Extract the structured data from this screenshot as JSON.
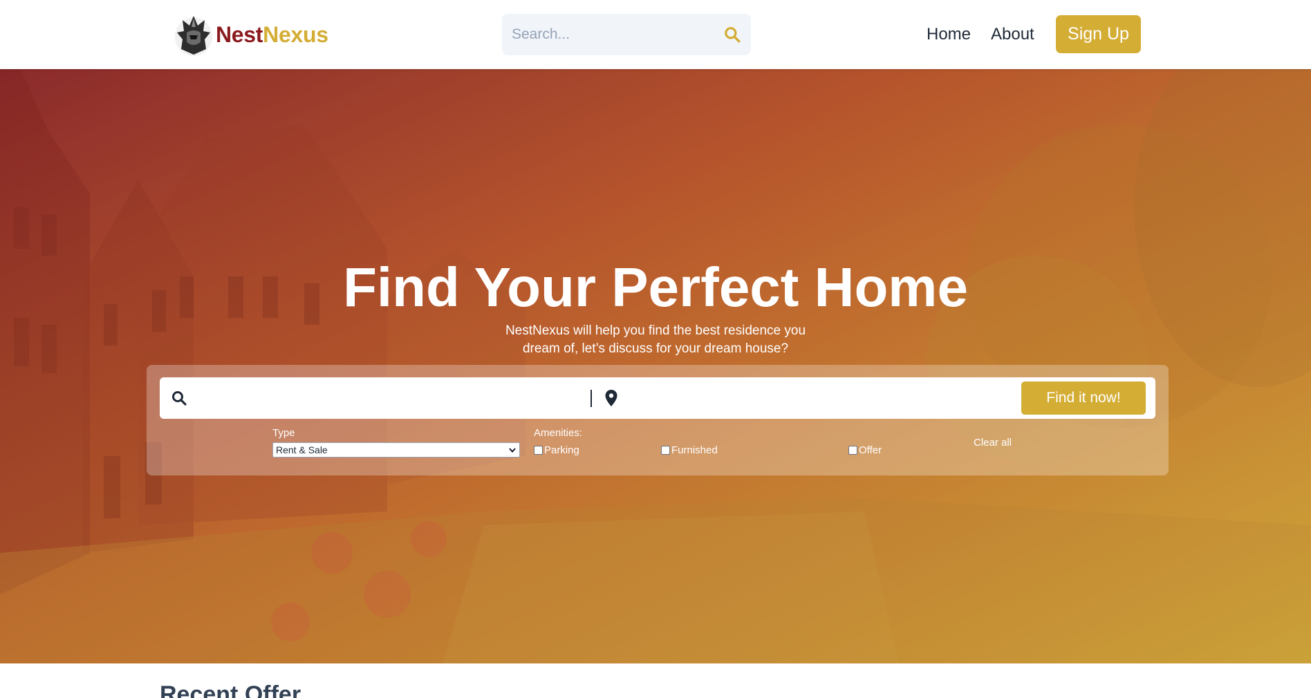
{
  "header": {
    "logo": {
      "part1": "Nest",
      "part2": "Nexus"
    },
    "search": {
      "placeholder": "Search..."
    },
    "nav": {
      "home": "Home",
      "about": "About"
    },
    "signup_label": "Sign Up"
  },
  "hero": {
    "title": "Find Your Perfect Home",
    "subtitle": "NestNexus will help you find the best residence you dream of, let’s discuss for your dream house?",
    "search_bar": {
      "query_value": "",
      "location_value": "",
      "button_label": "Find it now!"
    },
    "filters": {
      "type_label": "Type",
      "type_selected": "Rent & Sale",
      "amenities_label": "Amenities:",
      "options": [
        {
          "label": "Parking",
          "checked": false
        },
        {
          "label": "Furnished",
          "checked": false
        },
        {
          "label": "Offer",
          "checked": false
        }
      ],
      "clear_label": "Clear all"
    }
  },
  "recent": {
    "title": "Recent Offer"
  },
  "colors": {
    "accent": "#d4ad35",
    "brand_dark": "#8b1a1f",
    "text": "#334155"
  },
  "icons": [
    "crest-logo-icon",
    "search-icon",
    "location-pin-icon",
    "chevron-down-icon"
  ]
}
